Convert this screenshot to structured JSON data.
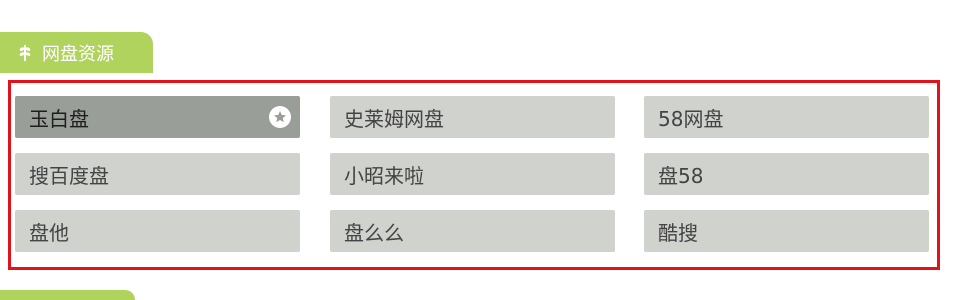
{
  "section": {
    "title": "网盘资源",
    "icon": "leaf-icon",
    "accent_color": "#b0d35d"
  },
  "panel": {
    "border_color": "#e3121a",
    "items": [
      {
        "label": "玉白盘",
        "active": true,
        "favorite_icon": "star-icon"
      },
      {
        "label": "史莱姆网盘",
        "active": false
      },
      {
        "label": "58网盘",
        "active": false
      },
      {
        "label": "搜百度盘",
        "active": false
      },
      {
        "label": "小昭来啦",
        "active": false
      },
      {
        "label": "盘58",
        "active": false
      },
      {
        "label": "盘他",
        "active": false
      },
      {
        "label": "盘么么",
        "active": false
      },
      {
        "label": "酷搜",
        "active": false
      }
    ]
  }
}
